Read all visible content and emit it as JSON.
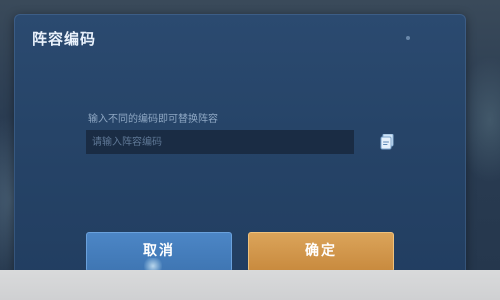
{
  "dialog": {
    "title": "阵容编码",
    "hint": "输入不同的编码即可替换阵容",
    "input_placeholder": "请输入阵容编码",
    "input_value": "",
    "paste_icon": "paste-icon",
    "cancel_label": "取消",
    "confirm_label": "确定"
  },
  "colors": {
    "dialog_bg": "#264468",
    "cancel_button": "#4580bd",
    "confirm_button": "#d49a4e",
    "title_text": "#e9f1fb"
  }
}
